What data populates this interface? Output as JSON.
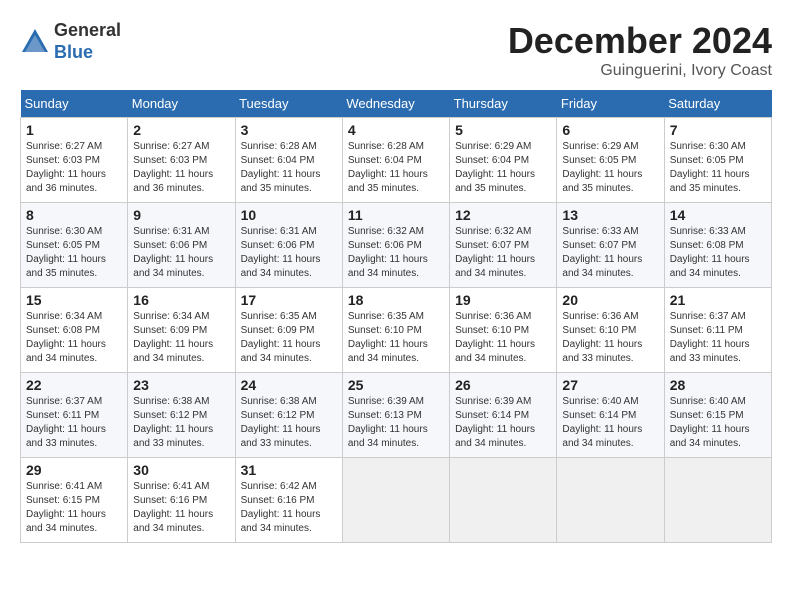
{
  "logo": {
    "general": "General",
    "blue": "Blue"
  },
  "header": {
    "title": "December 2024",
    "location": "Guinguerini, Ivory Coast"
  },
  "weekdays": [
    "Sunday",
    "Monday",
    "Tuesday",
    "Wednesday",
    "Thursday",
    "Friday",
    "Saturday"
  ],
  "weeks": [
    [
      {
        "day": 1,
        "sunrise": "6:27 AM",
        "sunset": "6:03 PM",
        "daylight": "11 hours and 36 minutes."
      },
      {
        "day": 2,
        "sunrise": "6:27 AM",
        "sunset": "6:03 PM",
        "daylight": "11 hours and 36 minutes."
      },
      {
        "day": 3,
        "sunrise": "6:28 AM",
        "sunset": "6:04 PM",
        "daylight": "11 hours and 35 minutes."
      },
      {
        "day": 4,
        "sunrise": "6:28 AM",
        "sunset": "6:04 PM",
        "daylight": "11 hours and 35 minutes."
      },
      {
        "day": 5,
        "sunrise": "6:29 AM",
        "sunset": "6:04 PM",
        "daylight": "11 hours and 35 minutes."
      },
      {
        "day": 6,
        "sunrise": "6:29 AM",
        "sunset": "6:05 PM",
        "daylight": "11 hours and 35 minutes."
      },
      {
        "day": 7,
        "sunrise": "6:30 AM",
        "sunset": "6:05 PM",
        "daylight": "11 hours and 35 minutes."
      }
    ],
    [
      {
        "day": 8,
        "sunrise": "6:30 AM",
        "sunset": "6:05 PM",
        "daylight": "11 hours and 35 minutes."
      },
      {
        "day": 9,
        "sunrise": "6:31 AM",
        "sunset": "6:06 PM",
        "daylight": "11 hours and 34 minutes."
      },
      {
        "day": 10,
        "sunrise": "6:31 AM",
        "sunset": "6:06 PM",
        "daylight": "11 hours and 34 minutes."
      },
      {
        "day": 11,
        "sunrise": "6:32 AM",
        "sunset": "6:06 PM",
        "daylight": "11 hours and 34 minutes."
      },
      {
        "day": 12,
        "sunrise": "6:32 AM",
        "sunset": "6:07 PM",
        "daylight": "11 hours and 34 minutes."
      },
      {
        "day": 13,
        "sunrise": "6:33 AM",
        "sunset": "6:07 PM",
        "daylight": "11 hours and 34 minutes."
      },
      {
        "day": 14,
        "sunrise": "6:33 AM",
        "sunset": "6:08 PM",
        "daylight": "11 hours and 34 minutes."
      }
    ],
    [
      {
        "day": 15,
        "sunrise": "6:34 AM",
        "sunset": "6:08 PM",
        "daylight": "11 hours and 34 minutes."
      },
      {
        "day": 16,
        "sunrise": "6:34 AM",
        "sunset": "6:09 PM",
        "daylight": "11 hours and 34 minutes."
      },
      {
        "day": 17,
        "sunrise": "6:35 AM",
        "sunset": "6:09 PM",
        "daylight": "11 hours and 34 minutes."
      },
      {
        "day": 18,
        "sunrise": "6:35 AM",
        "sunset": "6:10 PM",
        "daylight": "11 hours and 34 minutes."
      },
      {
        "day": 19,
        "sunrise": "6:36 AM",
        "sunset": "6:10 PM",
        "daylight": "11 hours and 34 minutes."
      },
      {
        "day": 20,
        "sunrise": "6:36 AM",
        "sunset": "6:10 PM",
        "daylight": "11 hours and 33 minutes."
      },
      {
        "day": 21,
        "sunrise": "6:37 AM",
        "sunset": "6:11 PM",
        "daylight": "11 hours and 33 minutes."
      }
    ],
    [
      {
        "day": 22,
        "sunrise": "6:37 AM",
        "sunset": "6:11 PM",
        "daylight": "11 hours and 33 minutes."
      },
      {
        "day": 23,
        "sunrise": "6:38 AM",
        "sunset": "6:12 PM",
        "daylight": "11 hours and 33 minutes."
      },
      {
        "day": 24,
        "sunrise": "6:38 AM",
        "sunset": "6:12 PM",
        "daylight": "11 hours and 33 minutes."
      },
      {
        "day": 25,
        "sunrise": "6:39 AM",
        "sunset": "6:13 PM",
        "daylight": "11 hours and 34 minutes."
      },
      {
        "day": 26,
        "sunrise": "6:39 AM",
        "sunset": "6:14 PM",
        "daylight": "11 hours and 34 minutes."
      },
      {
        "day": 27,
        "sunrise": "6:40 AM",
        "sunset": "6:14 PM",
        "daylight": "11 hours and 34 minutes."
      },
      {
        "day": 28,
        "sunrise": "6:40 AM",
        "sunset": "6:15 PM",
        "daylight": "11 hours and 34 minutes."
      }
    ],
    [
      {
        "day": 29,
        "sunrise": "6:41 AM",
        "sunset": "6:15 PM",
        "daylight": "11 hours and 34 minutes."
      },
      {
        "day": 30,
        "sunrise": "6:41 AM",
        "sunset": "6:16 PM",
        "daylight": "11 hours and 34 minutes."
      },
      {
        "day": 31,
        "sunrise": "6:42 AM",
        "sunset": "6:16 PM",
        "daylight": "11 hours and 34 minutes."
      },
      null,
      null,
      null,
      null
    ]
  ]
}
